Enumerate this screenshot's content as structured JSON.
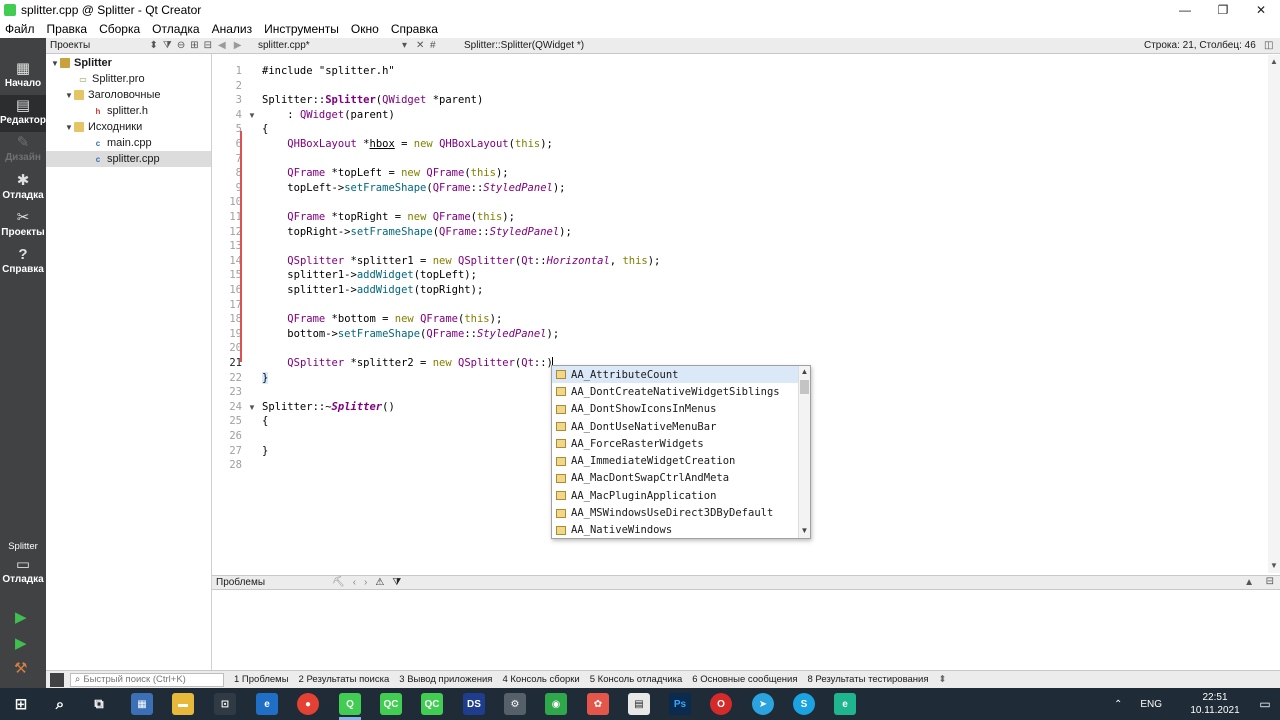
{
  "window": {
    "title": "splitter.cpp @ Splitter - Qt Creator",
    "controls": [
      "—",
      "❐",
      "✕"
    ]
  },
  "menu": [
    "Файл",
    "Правка",
    "Сборка",
    "Отладка",
    "Анализ",
    "Инструменты",
    "Окно",
    "Справка"
  ],
  "modes": [
    {
      "label": "Начало",
      "icon": "grid-icon"
    },
    {
      "label": "Редактор",
      "icon": "editor-icon"
    },
    {
      "label": "Дизайн",
      "icon": "pen-icon"
    },
    {
      "label": "Отладка",
      "icon": "bug-icon"
    },
    {
      "label": "Проекты",
      "icon": "wrench-icon"
    },
    {
      "label": "Справка",
      "icon": "help-icon"
    }
  ],
  "kit": {
    "name": "Splitter",
    "mode": "Отладка"
  },
  "projects": {
    "header": "Проекты",
    "tree": [
      {
        "label": "Splitter",
        "level": 0,
        "expanded": true,
        "kind": "project"
      },
      {
        "label": "Splitter.pro",
        "level": 1,
        "kind": "pro"
      },
      {
        "label": "Заголовочные",
        "level": 1,
        "expanded": true,
        "kind": "folder"
      },
      {
        "label": "splitter.h",
        "level": 2,
        "kind": "header"
      },
      {
        "label": "Исходники",
        "level": 1,
        "expanded": true,
        "kind": "folder"
      },
      {
        "label": "main.cpp",
        "level": 2,
        "kind": "source"
      },
      {
        "label": "splitter.cpp",
        "level": 2,
        "kind": "source",
        "selected": true
      }
    ]
  },
  "editor": {
    "file": "splitter.cpp*",
    "symbol": "Splitter::Splitter(QWidget *)",
    "position": "Строка: 21, Столбец: 46",
    "current_line": 21,
    "lines": [
      "1",
      "2",
      "3",
      "4",
      "5",
      "6",
      "7",
      "8",
      "9",
      "10",
      "11",
      "12",
      "13",
      "14",
      "15",
      "16",
      "17",
      "18",
      "19",
      "20",
      "21",
      "22",
      "23",
      "24",
      "25",
      "26",
      "27",
      "28"
    ],
    "code": {
      "l1": "#include \"splitter.h\"",
      "l3a": "Splitter::",
      "l3b": "Splitter",
      "l3c": "(",
      "l3d": "QWidget",
      "l3e": " *parent)",
      "l4a": "    : ",
      "l4b": "QWidget",
      "l4c": "(parent)",
      "l5": "{",
      "l6a": "    ",
      "l6b": "QHBoxLayout",
      "l6c": " *",
      "l6d": "hbox",
      "l6e": " = ",
      "l6f": "new",
      "l6g": " ",
      "l6h": "QHBoxLayout",
      "l6i": "(",
      "l6j": "this",
      "l6k": ");",
      "l8a": "    ",
      "l8b": "QFrame",
      "l8c": " *topLeft = ",
      "l8d": "new",
      "l8e": " ",
      "l8f": "QFrame",
      "l8g": "(",
      "l8h": "this",
      "l8i": ");",
      "l9a": "    topLeft->",
      "l9b": "setFrameShape",
      "l9c": "(",
      "l9d": "QFrame",
      "l9e": "::",
      "l9f": "StyledPanel",
      "l9g": ");",
      "l11a": "    ",
      "l11b": "QFrame",
      "l11c": " *topRight = ",
      "l11d": "new",
      "l11e": " ",
      "l11f": "QFrame",
      "l11g": "(",
      "l11h": "this",
      "l11i": ");",
      "l12a": "    topRight->",
      "l12b": "setFrameShape",
      "l12c": "(",
      "l12d": "QFrame",
      "l12e": "::",
      "l12f": "StyledPanel",
      "l12g": ");",
      "l14a": "    ",
      "l14b": "QSplitter",
      "l14c": " *splitter1 = ",
      "l14d": "new",
      "l14e": " ",
      "l14f": "QSplitter",
      "l14g": "(",
      "l14h": "Qt",
      "l14i": "::",
      "l14j": "Horizontal",
      "l14k": ", ",
      "l14l": "this",
      "l14m": ");",
      "l15a": "    splitter1->",
      "l15b": "addWidget",
      "l15c": "(topLeft);",
      "l16a": "    splitter1->",
      "l16b": "addWidget",
      "l16c": "(topRight);",
      "l18a": "    ",
      "l18b": "QFrame",
      "l18c": " *bottom = ",
      "l18d": "new",
      "l18e": " ",
      "l18f": "QFrame",
      "l18g": "(",
      "l18h": "this",
      "l18i": ");",
      "l19a": "    bottom->",
      "l19b": "setFrameShape",
      "l19c": "(",
      "l19d": "QFrame",
      "l19e": "::",
      "l19f": "StyledPanel",
      "l19g": ");",
      "l21a": "    ",
      "l21b": "QSplitter",
      "l21c": " *splitter2 = ",
      "l21d": "new",
      "l21e": " ",
      "l21f": "QSplitter",
      "l21g": "(",
      "l21h": "Qt",
      "l21i": "::)",
      "l22": "}",
      "l24a": "Splitter::~",
      "l24b": "Splitter",
      "l24c": "()",
      "l25": "{",
      "l27": "}"
    }
  },
  "completion": {
    "items": [
      "AA_AttributeCount",
      "AA_DontCreateNativeWidgetSiblings",
      "AA_DontShowIconsInMenus",
      "AA_DontUseNativeMenuBar",
      "AA_ForceRasterWidgets",
      "AA_ImmediateWidgetCreation",
      "AA_MacDontSwapCtrlAndMeta",
      "AA_MacPluginApplication",
      "AA_MSWindowsUseDirect3DByDefault",
      "AA_NativeWindows"
    ],
    "selected_index": 0
  },
  "output": {
    "title": "Проблемы"
  },
  "statusbar": {
    "search_placeholder": "Быстрый поиск (Ctrl+K)",
    "panes": [
      "1  Проблемы",
      "2  Результаты поиска",
      "3  Вывод приложения",
      "4  Консоль сборки",
      "5  Консоль отладчика",
      "6  Основные сообщения",
      "8  Результаты тестирования"
    ]
  },
  "taskbar": {
    "lang": "ENG",
    "time": "22:51",
    "date": "10.11.2021"
  },
  "colors": {
    "sidebar": "#404244",
    "keyword": "#808000",
    "type": "#800080",
    "function": "#00677c",
    "string": "#008000",
    "taskbar": "#1f2b36"
  }
}
